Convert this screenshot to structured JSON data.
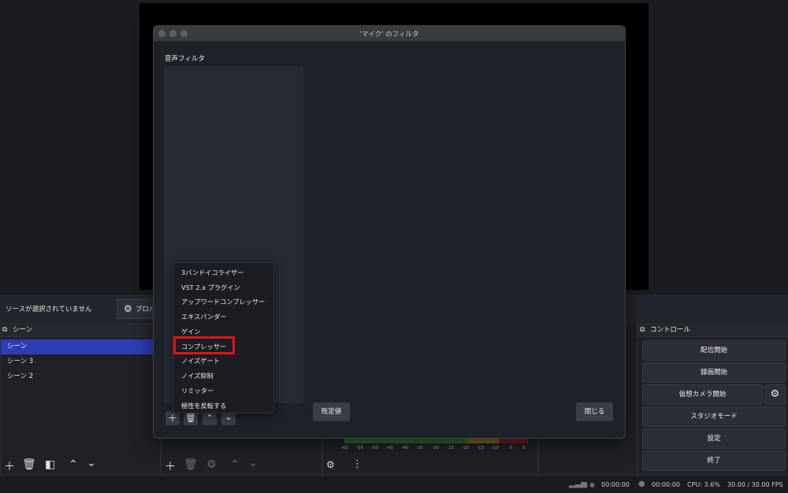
{
  "dialog": {
    "title": "'マイク' のフィルタ",
    "section_label": "音声フィルタ",
    "defaults_button": "既定値",
    "close_button": "閉じる"
  },
  "filter_menu": {
    "items": [
      "3バンドイコライザー",
      "VST 2.x プラグイン",
      "アップワードコンプレッサー",
      "エキスパンダー",
      "ゲイン",
      "コンプレッサー",
      "ノイズゲート",
      "ノイズ抑制",
      "リミッター",
      "極性を反転する"
    ],
    "highlighted": "コンプレッサー",
    "highlight_color": "#e0141a"
  },
  "source_bar": {
    "no_source_text": "ソースが選択されていません",
    "properties_label": "プロパ"
  },
  "scenes": {
    "title": "シーン",
    "items": [
      "シーン",
      "シーン 3",
      "シーン 2"
    ],
    "selected": "シーン",
    "selected_color": "#2e3db5"
  },
  "controls": {
    "title": "コントロール",
    "buttons": [
      "配信開始",
      "録画開始",
      "仮想カメラ開始",
      "スタジオモード",
      "設定",
      "終了"
    ]
  },
  "mixer": {
    "ticks": [
      "-60",
      "-55",
      "-50",
      "-45",
      "-40",
      "-35",
      "-30",
      "-25",
      "-20",
      "-15",
      "-10",
      "-5",
      "0"
    ]
  },
  "status_bar": {
    "stream_time": "00:00:00",
    "record_time": "00:00:00",
    "cpu": "CPU: 3.6%",
    "fps": "30.00 / 30.00 FPS"
  },
  "icons": [
    "plus-icon",
    "trash-icon",
    "chevron-up-icon",
    "chevron-down-icon",
    "gear-icon",
    "filter-icon",
    "more-icon",
    "scene-icon",
    "control-icon",
    "signal-icon",
    "record-dot-icon"
  ]
}
